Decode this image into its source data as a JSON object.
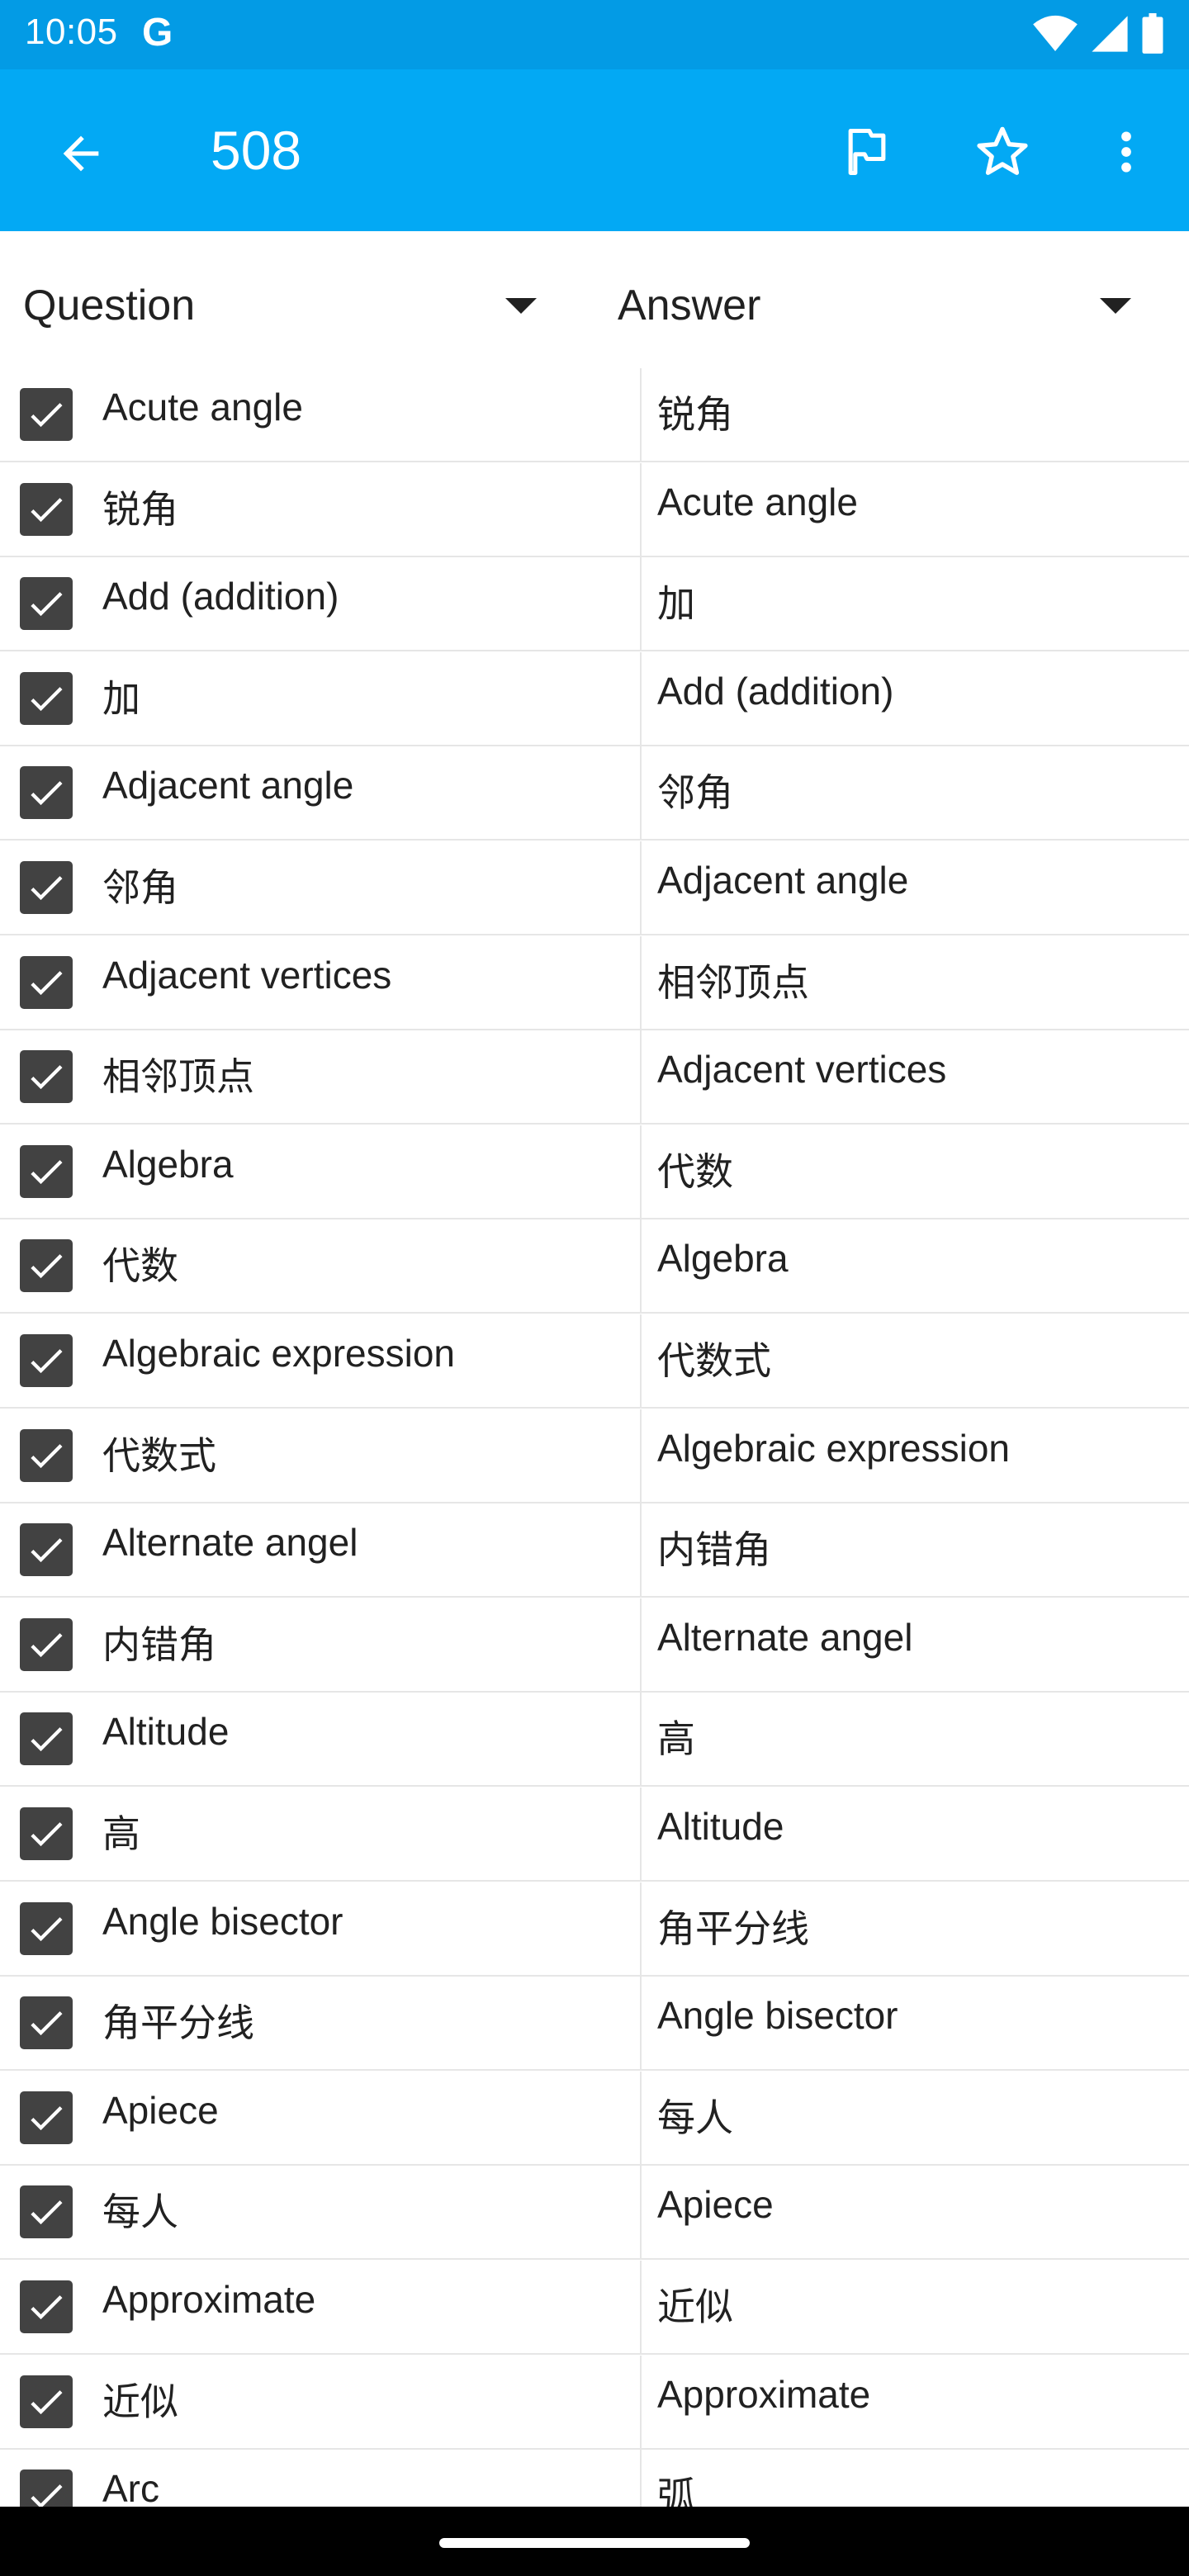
{
  "status_bar": {
    "time": "10:05",
    "g_logo": "G",
    "icons": [
      "wifi-icon",
      "cell-signal-icon",
      "battery-icon"
    ]
  },
  "app_bar": {
    "title": "508",
    "actions": [
      "flag-icon",
      "star-icon",
      "more-vert-icon"
    ],
    "color": "#03a9f4"
  },
  "header": {
    "question_label": "Question",
    "answer_label": "Answer"
  },
  "rows": [
    {
      "question": "Acute angle",
      "answer": "锐角",
      "checked": true
    },
    {
      "question": "锐角",
      "answer": "Acute angle",
      "checked": true
    },
    {
      "question": "Add (addition)",
      "answer": "加",
      "checked": true
    },
    {
      "question": "加",
      "answer": "Add (addition)",
      "checked": true
    },
    {
      "question": "Adjacent angle",
      "answer": "邻角",
      "checked": true
    },
    {
      "question": "邻角",
      "answer": "Adjacent angle",
      "checked": true
    },
    {
      "question": "Adjacent vertices",
      "answer": "相邻顶点",
      "checked": true
    },
    {
      "question": "相邻顶点",
      "answer": "Adjacent vertices",
      "checked": true
    },
    {
      "question": "Algebra",
      "answer": "代数",
      "checked": true
    },
    {
      "question": "代数",
      "answer": "Algebra",
      "checked": true
    },
    {
      "question": "Algebraic expression",
      "answer": "代数式",
      "checked": true
    },
    {
      "question": "代数式",
      "answer": "Algebraic expression",
      "checked": true
    },
    {
      "question": "Alternate angel",
      "answer": "内错角",
      "checked": true
    },
    {
      "question": "内错角",
      "answer": "Alternate angel",
      "checked": true
    },
    {
      "question": "Altitude",
      "answer": "高",
      "checked": true
    },
    {
      "question": "高",
      "answer": "Altitude",
      "checked": true
    },
    {
      "question": "Angle bisector",
      "answer": "角平分线",
      "checked": true
    },
    {
      "question": "角平分线",
      "answer": "Angle bisector",
      "checked": true
    },
    {
      "question": "Apiece",
      "answer": "每人",
      "checked": true
    },
    {
      "question": "每人",
      "answer": "Apiece",
      "checked": true
    },
    {
      "question": "Approximate",
      "answer": "近似",
      "checked": true
    },
    {
      "question": "近似",
      "answer": "Approximate",
      "checked": true
    },
    {
      "question": "Arc",
      "answer": "弧",
      "checked": true
    }
  ]
}
